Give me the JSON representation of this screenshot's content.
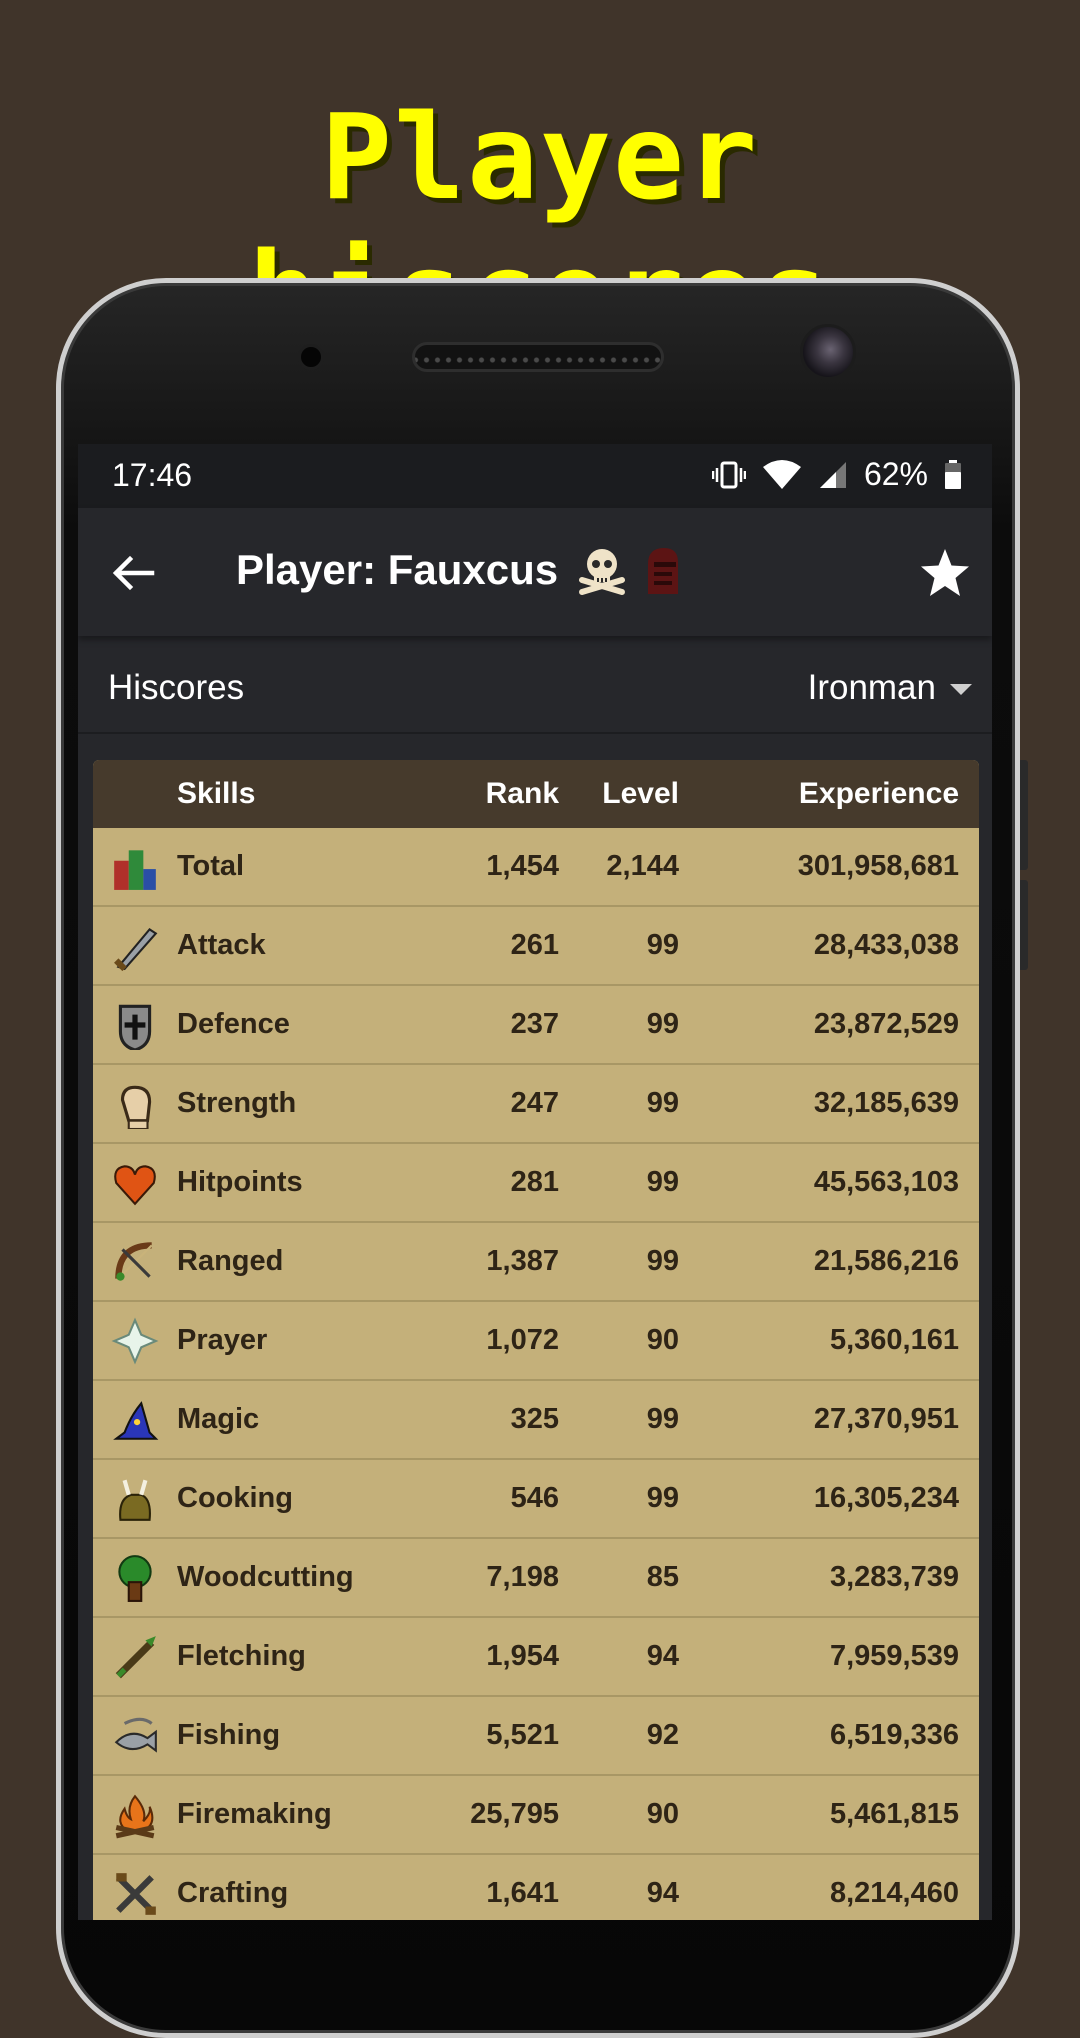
{
  "promo": {
    "title": "Player hiscores"
  },
  "status_bar": {
    "time": "17:46",
    "battery": "62%"
  },
  "toolbar": {
    "title": "Player: Fauxcus"
  },
  "subbar": {
    "label": "Hiscores",
    "mode": "Ironman"
  },
  "table": {
    "headers": {
      "skills": "Skills",
      "rank": "Rank",
      "level": "Level",
      "experience": "Experience"
    },
    "rows": [
      {
        "skill": "Total",
        "icon": "total-icon",
        "rank": "1,454",
        "level": "2,144",
        "experience": "301,958,681"
      },
      {
        "skill": "Attack",
        "icon": "attack-icon",
        "rank": "261",
        "level": "99",
        "experience": "28,433,038"
      },
      {
        "skill": "Defence",
        "icon": "defence-icon",
        "rank": "237",
        "level": "99",
        "experience": "23,872,529"
      },
      {
        "skill": "Strength",
        "icon": "strength-icon",
        "rank": "247",
        "level": "99",
        "experience": "32,185,639"
      },
      {
        "skill": "Hitpoints",
        "icon": "hitpoints-icon",
        "rank": "281",
        "level": "99",
        "experience": "45,563,103"
      },
      {
        "skill": "Ranged",
        "icon": "ranged-icon",
        "rank": "1,387",
        "level": "99",
        "experience": "21,586,216"
      },
      {
        "skill": "Prayer",
        "icon": "prayer-icon",
        "rank": "1,072",
        "level": "90",
        "experience": "5,360,161"
      },
      {
        "skill": "Magic",
        "icon": "magic-icon",
        "rank": "325",
        "level": "99",
        "experience": "27,370,951"
      },
      {
        "skill": "Cooking",
        "icon": "cooking-icon",
        "rank": "546",
        "level": "99",
        "experience": "16,305,234"
      },
      {
        "skill": "Woodcutting",
        "icon": "woodcutting-icon",
        "rank": "7,198",
        "level": "85",
        "experience": "3,283,739"
      },
      {
        "skill": "Fletching",
        "icon": "fletching-icon",
        "rank": "1,954",
        "level": "94",
        "experience": "7,959,539"
      },
      {
        "skill": "Fishing",
        "icon": "fishing-icon",
        "rank": "5,521",
        "level": "92",
        "experience": "6,519,336"
      },
      {
        "skill": "Firemaking",
        "icon": "firemaking-icon",
        "rank": "25,795",
        "level": "90",
        "experience": "5,461,815"
      },
      {
        "skill": "Crafting",
        "icon": "crafting-icon",
        "rank": "1,641",
        "level": "94",
        "experience": "8,214,460"
      }
    ]
  },
  "colors": {
    "accent_title": "#ffff00",
    "table_bg": "#c4b07a",
    "table_header": "#463a2c"
  }
}
